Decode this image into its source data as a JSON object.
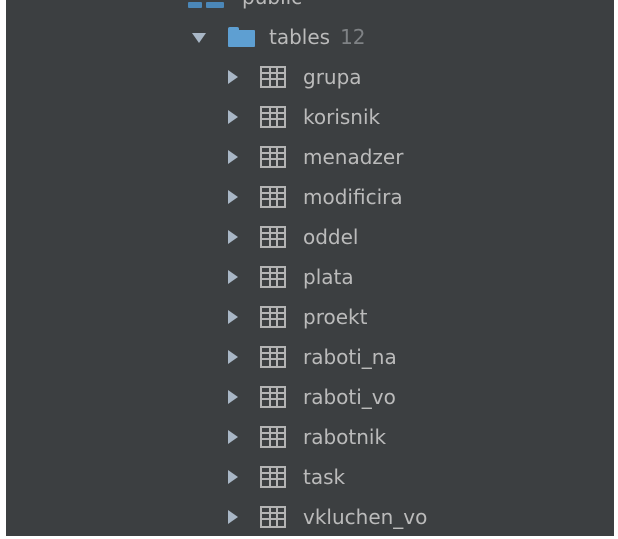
{
  "tree": {
    "parent_label": "public",
    "folder": {
      "label": "tables",
      "count": "12",
      "icon": "folder-icon"
    },
    "tables": [
      {
        "label": "grupa",
        "icon": "table-icon"
      },
      {
        "label": "korisnik",
        "icon": "table-icon"
      },
      {
        "label": "menadzer",
        "icon": "table-icon"
      },
      {
        "label": "modificira",
        "icon": "table-icon"
      },
      {
        "label": "oddel",
        "icon": "table-icon"
      },
      {
        "label": "plata",
        "icon": "table-icon"
      },
      {
        "label": "proekt",
        "icon": "table-icon"
      },
      {
        "label": "raboti_na",
        "icon": "table-icon"
      },
      {
        "label": "raboti_vo",
        "icon": "table-icon"
      },
      {
        "label": "rabotnik",
        "icon": "table-icon"
      },
      {
        "label": "task",
        "icon": "table-icon"
      },
      {
        "label": "vkluchen_vo",
        "icon": "table-icon"
      }
    ]
  },
  "colors": {
    "background": "#3c3f41",
    "text": "#bbbbbb",
    "count_text": "#7f8285",
    "folder": "#5e9fd2",
    "arrow": "#a9b7c6"
  }
}
